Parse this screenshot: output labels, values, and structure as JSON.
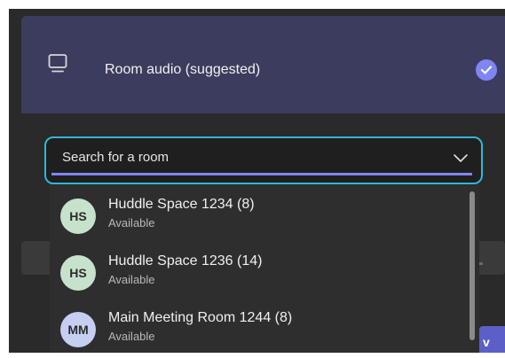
{
  "room_audio": {
    "label": "Room audio (suggested)",
    "icon": "monitor-icon",
    "selected": true
  },
  "search": {
    "placeholder": "Search for a room",
    "value": ""
  },
  "rooms": [
    {
      "initials": "HS",
      "name": "Huddle Space 1234 (8)",
      "status": "Available",
      "avatar_color": "#c7e2cc"
    },
    {
      "initials": "HS",
      "name": "Huddle Space 1236 (14)",
      "status": "Available",
      "avatar_color": "#c7e2cc"
    },
    {
      "initials": "MM",
      "name": "Main Meeting Room 1244 (8)",
      "status": "Available",
      "avatar_color": "#c6cff2"
    }
  ],
  "action_button": {
    "label": "v"
  },
  "colors": {
    "accent": "#7f85f5",
    "focus_ring": "#2eb7d8",
    "card_bg": "#3c3c5e",
    "button_bg": "#5b5fc7"
  }
}
